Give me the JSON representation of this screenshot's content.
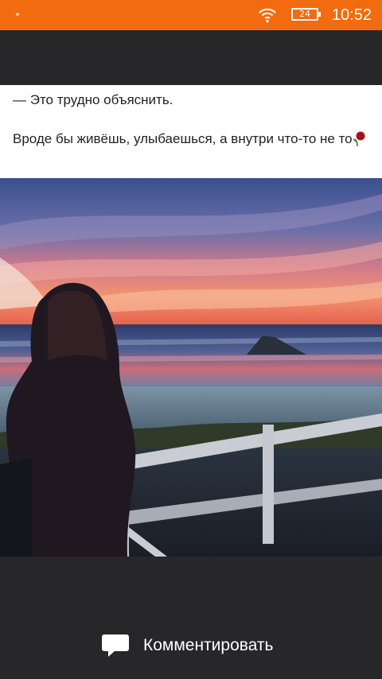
{
  "status_bar": {
    "time": "10:52",
    "battery_level": "24",
    "wifi_icon": "wifi-icon",
    "background_color": "#f26b0f"
  },
  "post": {
    "line1": "— Это трудно объяснить.",
    "line2": "Вроде бы живёшь, улыбаешься, а внутри что-то не то",
    "emoji_icon": "wilted-rose-icon",
    "image_icon": "photo-girl-at-sunset-beach"
  },
  "actions": {
    "comment_label": "Комментировать",
    "comment_icon": "speech-bubble-icon"
  }
}
